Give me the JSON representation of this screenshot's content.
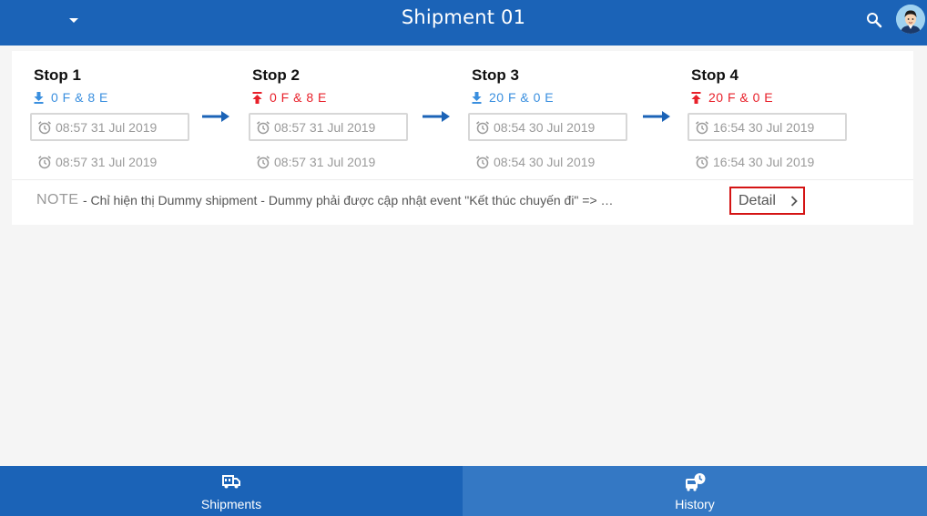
{
  "header": {
    "title": "Shipment 01",
    "menu_icon": "caret-down-icon",
    "search_icon": "search-icon",
    "avatar_icon": "user-avatar"
  },
  "stops": [
    {
      "name": "Stop 1",
      "direction": "down",
      "load": "0 F  & 8 E",
      "planned_time": "08:57 31 Jul 2019",
      "actual_time": "08:57 31 Jul 2019"
    },
    {
      "name": "Stop 2",
      "direction": "up",
      "load": "0 F  & 8 E",
      "planned_time": "08:57 31 Jul 2019",
      "actual_time": "08:57 31 Jul 2019"
    },
    {
      "name": "Stop 3",
      "direction": "down",
      "load": "20 F  & 0 E",
      "planned_time": "08:54 30 Jul 2019",
      "actual_time": "08:54 30 Jul 2019"
    },
    {
      "name": "Stop 4",
      "direction": "up",
      "load": "20 F  & 0 E",
      "planned_time": "16:54 30 Jul 2019",
      "actual_time": "16:54 30 Jul 2019"
    }
  ],
  "note": {
    "label": "NOTE",
    "text": "- Chỉ hiện thị Dummy shipment - Dummy phải được cập nhật event \"Kết thúc chuyến đi\" => hiển thị"
  },
  "detail_button": {
    "label": "Detail"
  },
  "tabs": [
    {
      "label": "Shipments",
      "icon": "truck-icon",
      "active": true
    },
    {
      "label": "History",
      "icon": "bus-history-icon",
      "active": false
    }
  ],
  "colors": {
    "primary": "#1b63b7",
    "download": "#3a8fdf",
    "upload": "#e8202a",
    "highlight_border": "#d41414"
  }
}
